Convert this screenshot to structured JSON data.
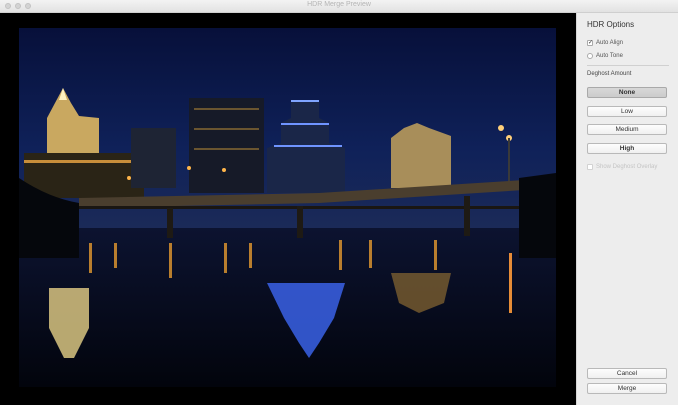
{
  "window": {
    "title": "HDR Merge Preview"
  },
  "panel": {
    "title": "HDR Options",
    "auto_align": {
      "label": "Auto Align",
      "checked": true,
      "mark": "✓"
    },
    "auto_tone": {
      "label": "Auto Tone",
      "checked": false
    },
    "deghost_label": "Deghost Amount",
    "deghost_options": [
      "None",
      "Low",
      "Medium",
      "High"
    ],
    "deghost_selected": "None",
    "show_overlay": {
      "label": "Show Deghost Overlay",
      "enabled": false
    },
    "cancel_label": "Cancel",
    "merge_label": "Merge"
  },
  "colors": {
    "panel_bg": "#ededed",
    "viewport_bg": "#000000",
    "sky": "#0c1a45"
  },
  "preview": {
    "content": "night city skyline reflected in river"
  }
}
